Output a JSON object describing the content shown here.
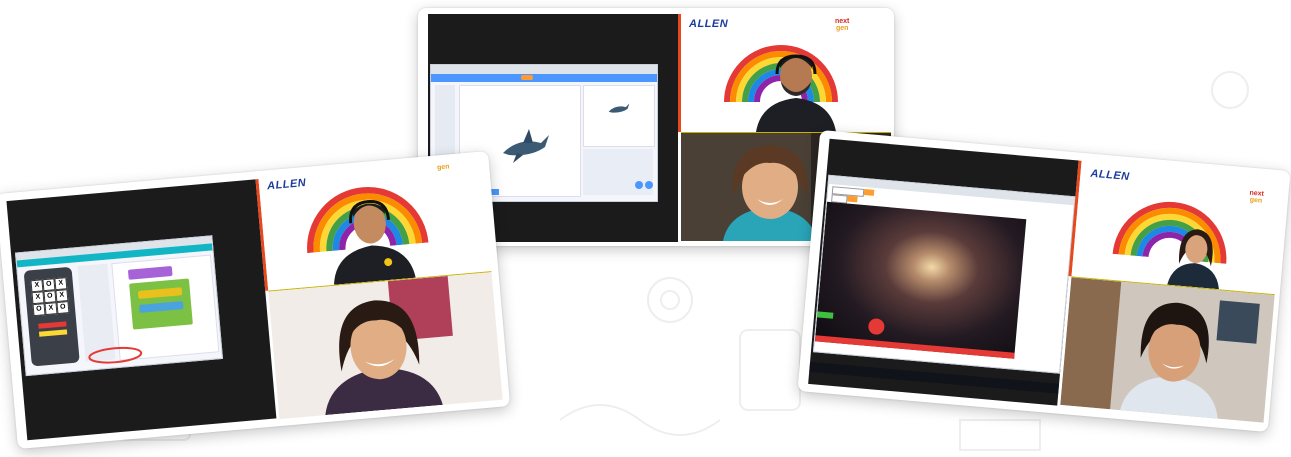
{
  "brand": {
    "name": "ALLEN",
    "partner_logo": "next-gen"
  },
  "colors": {
    "brand_blue": "#1c3c9c",
    "accent_red": "#e7481d",
    "screen_dark": "#1b1b1b",
    "scratch_blue": "#4c97ff"
  },
  "cards": [
    {
      "id": "left-session",
      "shared_app": "block-coding-tic-tac-toe",
      "ttt_grid": [
        "X",
        "O",
        "X",
        "X",
        "O",
        "X",
        "O",
        "X",
        "O"
      ]
    },
    {
      "id": "center-session",
      "shared_app": "scratch-editor-shark-sprite"
    },
    {
      "id": "right-session",
      "shared_app": "space-galaxy-game"
    }
  ],
  "icons": [
    "rainbow-icon",
    "headset-icon"
  ]
}
